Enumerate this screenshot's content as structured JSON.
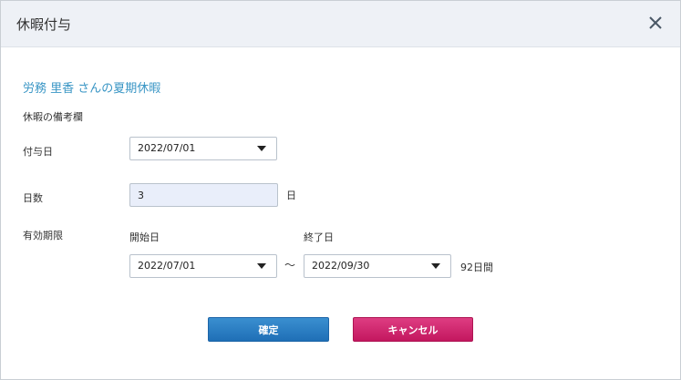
{
  "dialog": {
    "title": "休暇付与",
    "subject": "労務 里香 さんの夏期休暇",
    "remarks_label": "休暇の備考欄"
  },
  "grant_date": {
    "label": "付与日",
    "value": "2022/07/01"
  },
  "days": {
    "label": "日数",
    "value": "3",
    "unit": "日"
  },
  "validity": {
    "label": "有効期限",
    "start_label": "開始日",
    "start_value": "2022/07/01",
    "separator": "～",
    "end_label": "終了日",
    "end_value": "2022/09/30",
    "duration": "92日間"
  },
  "buttons": {
    "confirm": "確定",
    "cancel": "キャンセル"
  },
  "colors": {
    "subject_text": "#3a96c5",
    "confirm_button": "#2574bb",
    "cancel_button": "#cf2168",
    "header_bg": "#eef1f6"
  },
  "icons": {
    "close": "close-icon",
    "dropdown": "chevron-down-icon"
  }
}
